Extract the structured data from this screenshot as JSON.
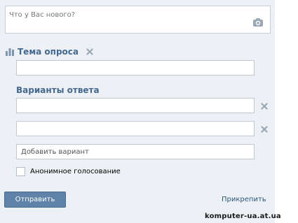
{
  "post": {
    "placeholder": "Что у Вас нового?",
    "camera_icon": "camera-icon"
  },
  "poll": {
    "title": "Тема опроса",
    "title_icon": "poll-bars-icon",
    "remove_icon": "close-icon",
    "topic_value": "",
    "answers_title": "Варианты ответа",
    "answers": [
      {
        "value": ""
      },
      {
        "value": ""
      }
    ],
    "add_option_placeholder": "Добавить вариант",
    "anonymous_label": "Анонимное голосование",
    "anonymous_checked": false
  },
  "actions": {
    "send_label": "Отправить",
    "attach_label": "Прикрепить"
  },
  "watermark": "komputer-ua.at.ua",
  "colors": {
    "panel_bg": "#edf1f5",
    "accent": "#45688e",
    "button_bg": "#5e82a8",
    "link": "#2b587a",
    "icon_gray": "#9aa8b6"
  }
}
